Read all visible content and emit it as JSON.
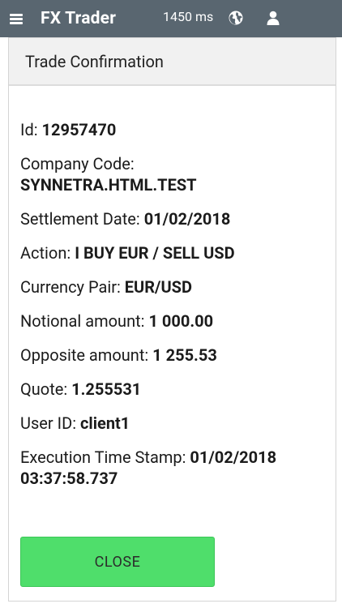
{
  "header": {
    "app_title": "FX Trader",
    "latency": "1450 ms",
    "icons": [
      "menu-icon",
      "globe-icon",
      "user-icon"
    ],
    "background": "#596670"
  },
  "panel": {
    "title": "Trade Confirmation"
  },
  "trade": {
    "id_label": "Id:",
    "id_value": "12957470",
    "company_label": "Company Code:",
    "company_value": "SYNNETRA.HTML.TEST",
    "settlement_label": "Settlement Date:",
    "settlement_value": "01/02/2018",
    "action_label": "Action:",
    "action_value": "I BUY EUR / SELL USD",
    "pair_label": "Currency Pair:",
    "pair_value": "EUR/USD",
    "notional_label": "Notional amount:",
    "notional_value": "1 000.00",
    "opposite_label": "Opposite amount:",
    "opposite_value": "1 255.53",
    "quote_label": "Quote:",
    "quote_value": "1.255531",
    "user_label": "User ID:",
    "user_value": "client1",
    "timestamp_label": "Execution Time Stamp:",
    "timestamp_date": "01/02/2018",
    "timestamp_time": "03:37:58.737"
  },
  "actions": {
    "close_label": "CLOSE",
    "close_color": "#4fde6b"
  }
}
